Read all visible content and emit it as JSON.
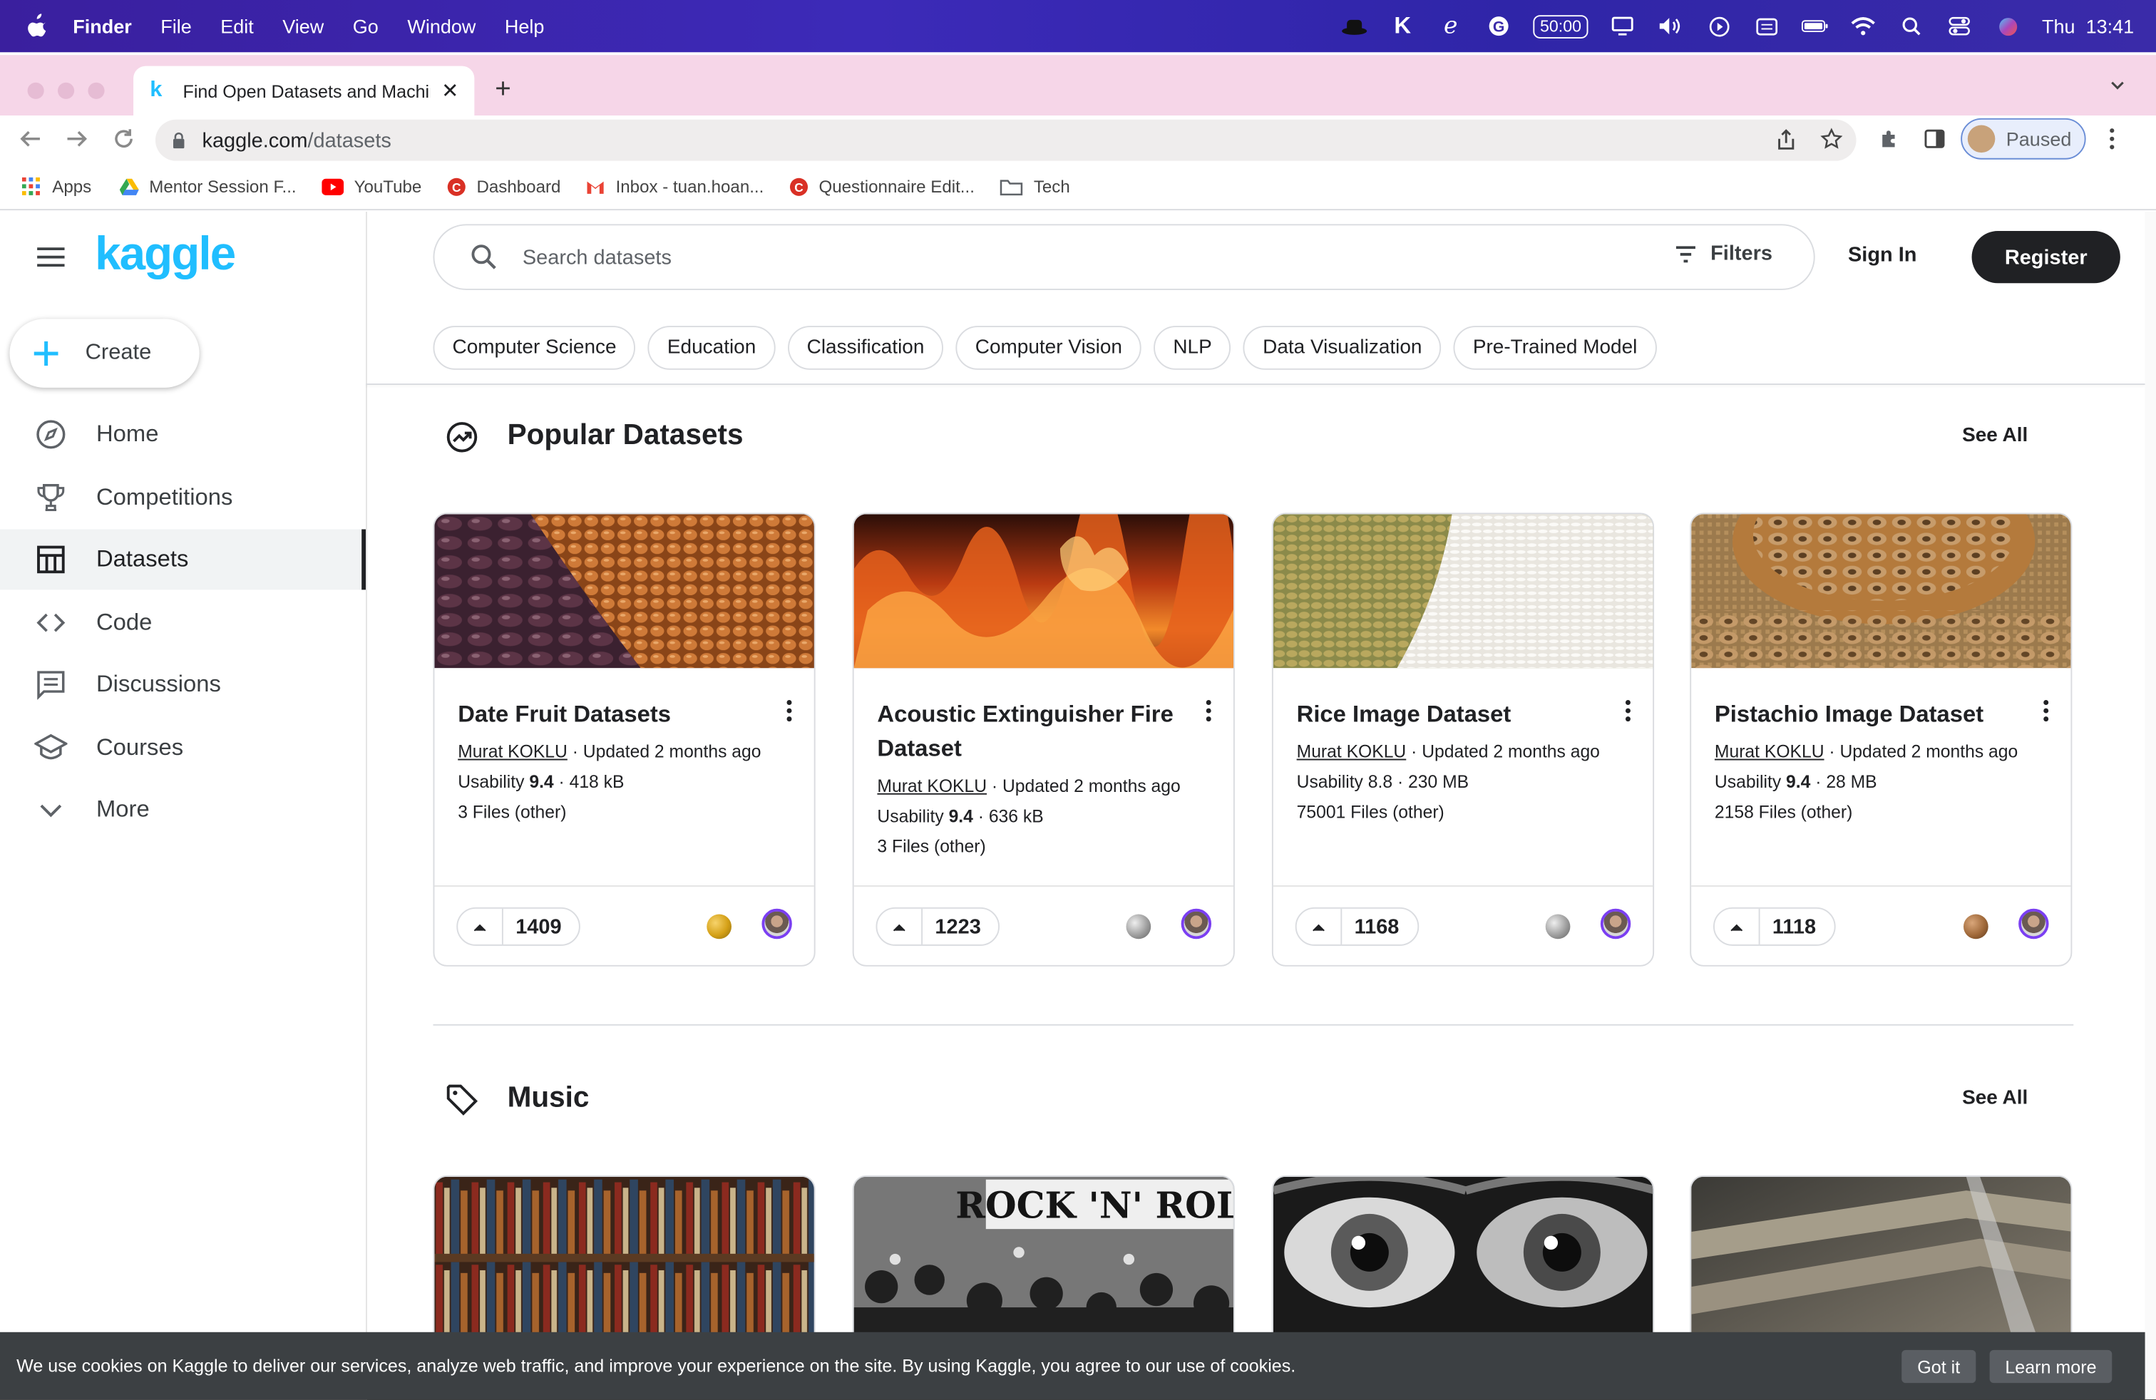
{
  "menubar": {
    "app": "Finder",
    "items": [
      "File",
      "Edit",
      "View",
      "Go",
      "Window",
      "Help"
    ],
    "timer": "50:00",
    "clock": "Thu  13:41"
  },
  "browser": {
    "tab_title": "Find Open Datasets and Machine Learning Projects | Kaggle",
    "url_host": "kaggle.com",
    "url_path": "/datasets",
    "profile_status": "Paused",
    "bookmarks": [
      {
        "label": "Apps",
        "icon": "apps-grid-icon"
      },
      {
        "label": "Mentor Session F...",
        "icon": "google-drive-icon"
      },
      {
        "label": "YouTube",
        "icon": "youtube-icon"
      },
      {
        "label": "Dashboard",
        "icon": "coursera-icon"
      },
      {
        "label": "Inbox - tuan.hoan...",
        "icon": "gmail-icon"
      },
      {
        "label": "Questionnaire Edit...",
        "icon": "coursera-icon"
      },
      {
        "label": "Tech",
        "icon": "folder-icon"
      }
    ]
  },
  "sidebar": {
    "logo": "kaggle",
    "create_label": "Create",
    "items": [
      {
        "label": "Home",
        "icon": "compass-icon"
      },
      {
        "label": "Competitions",
        "icon": "trophy-icon"
      },
      {
        "label": "Datasets",
        "icon": "table-icon",
        "active": true
      },
      {
        "label": "Code",
        "icon": "code-icon"
      },
      {
        "label": "Discussions",
        "icon": "comment-icon"
      },
      {
        "label": "Courses",
        "icon": "school-icon"
      },
      {
        "label": "More",
        "icon": "chevron-down-icon"
      }
    ]
  },
  "header": {
    "search_placeholder": "Search datasets",
    "filters_label": "Filters",
    "signin_label": "Sign In",
    "register_label": "Register",
    "chips": [
      "Computer Science",
      "Education",
      "Classification",
      "Computer Vision",
      "NLP",
      "Data Visualization",
      "Pre-Trained Model"
    ]
  },
  "popular": {
    "title": "Popular Datasets",
    "see_all": "See All",
    "cards": [
      {
        "title": "Date Fruit Datasets",
        "author": "Murat KOKLU",
        "updated": " · Updated 2 months ago",
        "usability_label": "Usability ",
        "usability": "9.4",
        "usability_bold": true,
        "size": " · 418 kB",
        "files": "3 Files (other)",
        "votes": "1409",
        "medal": "gold"
      },
      {
        "title": "Acoustic Extinguisher Fire Dataset",
        "author": "Murat KOKLU",
        "updated": " · Updated 2 months ago",
        "usability_label": "Usability ",
        "usability": "9.4",
        "usability_bold": true,
        "size": " · 636 kB",
        "files": "3 Files (other)",
        "votes": "1223",
        "medal": "silver"
      },
      {
        "title": "Rice Image Dataset",
        "author": "Murat KOKLU",
        "updated": " · Updated 2 months ago",
        "usability_label": "Usability ",
        "usability": "8.8",
        "usability_bold": false,
        "size": " · 230 MB",
        "files": "75001 Files (other)",
        "votes": "1168",
        "medal": "silver"
      },
      {
        "title": "Pistachio Image Dataset",
        "author": "Murat KOKLU",
        "updated": " · Updated 2 months ago",
        "usability_label": "Usability ",
        "usability": "9.4",
        "usability_bold": true,
        "size": " · 28 MB",
        "files": "2158 Files (other)",
        "votes": "1118",
        "medal": "bronze"
      }
    ]
  },
  "music": {
    "title": "Music",
    "see_all": "See All",
    "card_texts": [
      "ROCK 'N' ROLL"
    ]
  },
  "cookie": {
    "text": "We use cookies on Kaggle to deliver our services, analyze web traffic, and improve your experience on the site. By using Kaggle, you agree to our use of cookies.",
    "got_it": "Got it",
    "learn_more": "Learn more"
  },
  "colors": {
    "kaggle_blue": "#20beff",
    "medal_gold": "#d4a017",
    "medal_silver": "#9e9e9e",
    "medal_bronze": "#a0693a"
  }
}
